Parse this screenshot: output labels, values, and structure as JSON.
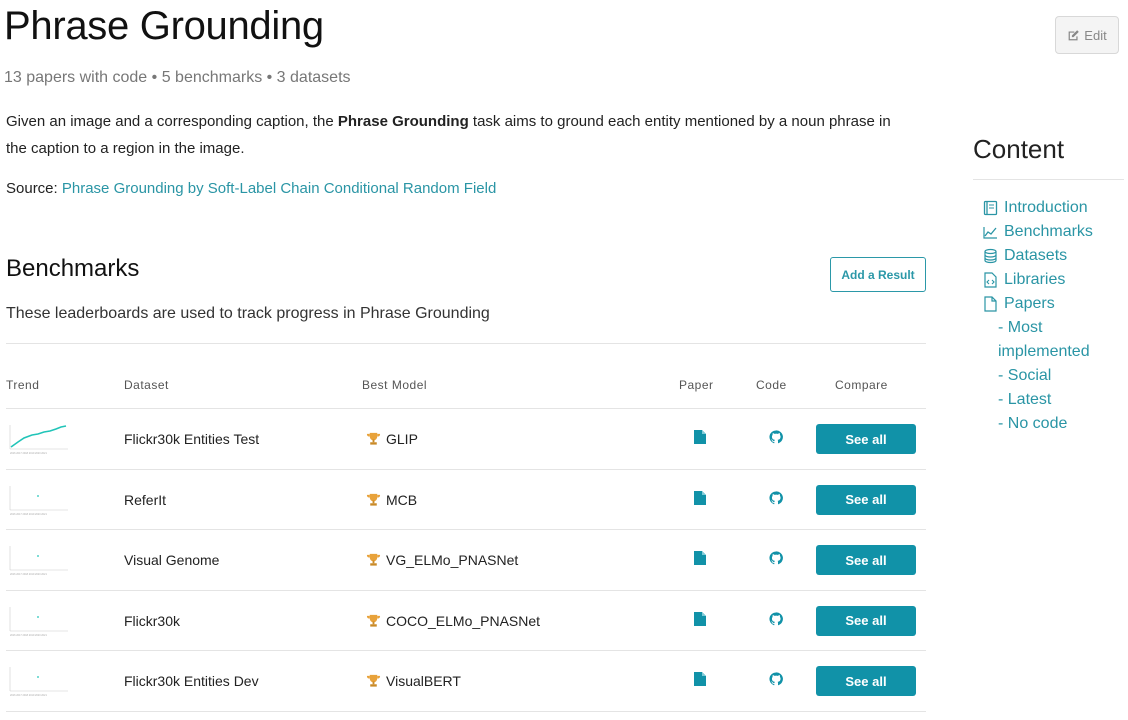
{
  "page": {
    "title": "Phrase Grounding",
    "edit_label": "Edit",
    "stats": "13 papers with code • 5 benchmarks • 3 datasets",
    "description_prefix": "Given an image and a corresponding caption, the ",
    "description_bold": "Phrase Grounding",
    "description_suffix": " task aims to ground each entity mentioned by a noun phrase in the caption to a region in the image.",
    "source_label": "Source: ",
    "source_link": "Phrase Grounding by Soft-Label Chain Conditional Random Field"
  },
  "benchmarks": {
    "title": "Benchmarks",
    "add_result_label": "Add a Result",
    "subtitle": "These leaderboards are used to track progress in Phrase Grounding",
    "columns": {
      "trend": "Trend",
      "dataset": "Dataset",
      "best_model": "Best Model",
      "paper": "Paper",
      "code": "Code",
      "compare": "Compare"
    },
    "rows": [
      {
        "dataset": "Flickr30k Entities Test",
        "model": "GLIP",
        "see_all": "See all"
      },
      {
        "dataset": "ReferIt",
        "model": "MCB",
        "see_all": "See all"
      },
      {
        "dataset": "Visual Genome",
        "model": "VG_ELMo_PNASNet",
        "see_all": "See all"
      },
      {
        "dataset": "Flickr30k",
        "model": "COCO_ELMo_PNASNet",
        "see_all": "See all"
      },
      {
        "dataset": "Flickr30k Entities Dev",
        "model": "VisualBERT",
        "see_all": "See all"
      }
    ]
  },
  "sidebar": {
    "title": "Content",
    "items": [
      {
        "label": "Introduction",
        "icon": "book-icon"
      },
      {
        "label": "Benchmarks",
        "icon": "trend-chart-icon"
      },
      {
        "label": "Datasets",
        "icon": "database-icon"
      },
      {
        "label": "Libraries",
        "icon": "code-file-icon"
      },
      {
        "label": "Papers",
        "icon": "document-icon"
      }
    ],
    "subitems": [
      "- Most implemented",
      "- Social",
      "- Latest",
      "- No code"
    ]
  },
  "colors": {
    "accent": "#1192a8",
    "link": "#2a95a5",
    "trophy": "#e8a23a"
  }
}
